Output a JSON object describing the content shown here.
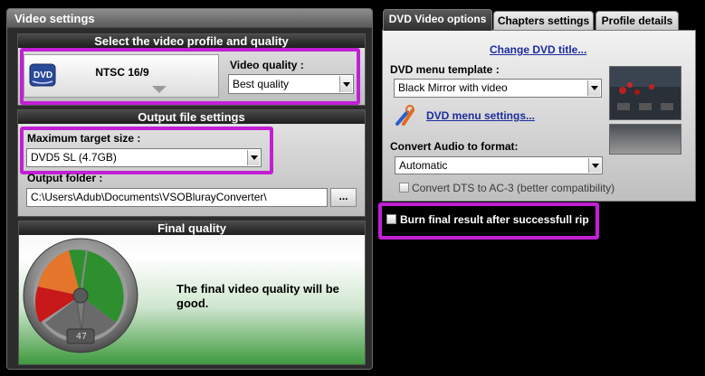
{
  "left": {
    "title": "Video settings",
    "profile_group": {
      "header": "Select the video profile and quality",
      "profile_name": "NTSC 16/9",
      "quality_label": "Video quality :",
      "quality_value": "Best quality"
    },
    "output_group": {
      "header": "Output file settings",
      "size_label": "Maximum target size :",
      "size_value": "DVD5 SL (4.7GB)",
      "folder_label": "Output folder :",
      "folder_value": "C:\\Users\\Adub\\Documents\\VSOBlurayConverter\\",
      "browse_label": "..."
    },
    "final_group": {
      "header": "Final quality",
      "message": "The final video quality will be good.",
      "gauge_readout": "47"
    }
  },
  "tabs": [
    {
      "label": "DVD Video options"
    },
    {
      "label": "Chapters settings"
    },
    {
      "label": "Profile details"
    }
  ],
  "dvd": {
    "change_title_link": "Change DVD title...",
    "menu_template_label": "DVD menu template :",
    "menu_template_value": "Black Mirror with video",
    "menu_settings_link": "DVD menu settings...",
    "audio_label": "Convert Audio to format:",
    "audio_value": "Automatic",
    "dts_label": "Convert DTS to AC-3 (better compatibility)",
    "burn_label": "Burn final result after successfull rip"
  },
  "icons": {
    "dvd_disc": "dvd-disc-icon",
    "settings": "wrench-screwdriver-icon",
    "dropdown": "chevron-down-icon",
    "gauge": "quality-gauge-icon"
  },
  "colors": {
    "highlight": "#c21fd4",
    "link": "#1c2c9e"
  }
}
